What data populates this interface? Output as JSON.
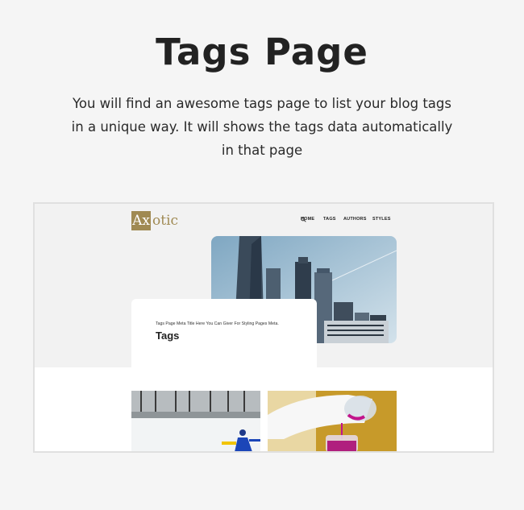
{
  "page": {
    "title": "Tags Page",
    "description": "You will find an awesome tags page to list your blog tags in a unique way. It will shows the tags data automatically in that page"
  },
  "preview": {
    "logo": {
      "box_text": "Ax",
      "rest_text": "otic"
    },
    "nav": {
      "items": [
        "HOME",
        "TAGS",
        "AUTHORS",
        "STYLES"
      ],
      "search_icon": "search-icon"
    },
    "hero_image": "city-skyscrapers-image",
    "card": {
      "meta": "Tags Page Meta Title Here You Can Giver For Styling Pages Meta.",
      "title": "Tags"
    },
    "thumbnails": [
      "snowy-field-image",
      "lab-pouring-image"
    ]
  },
  "colors": {
    "brand": "#a08a53",
    "background": "#f5f5f5"
  }
}
